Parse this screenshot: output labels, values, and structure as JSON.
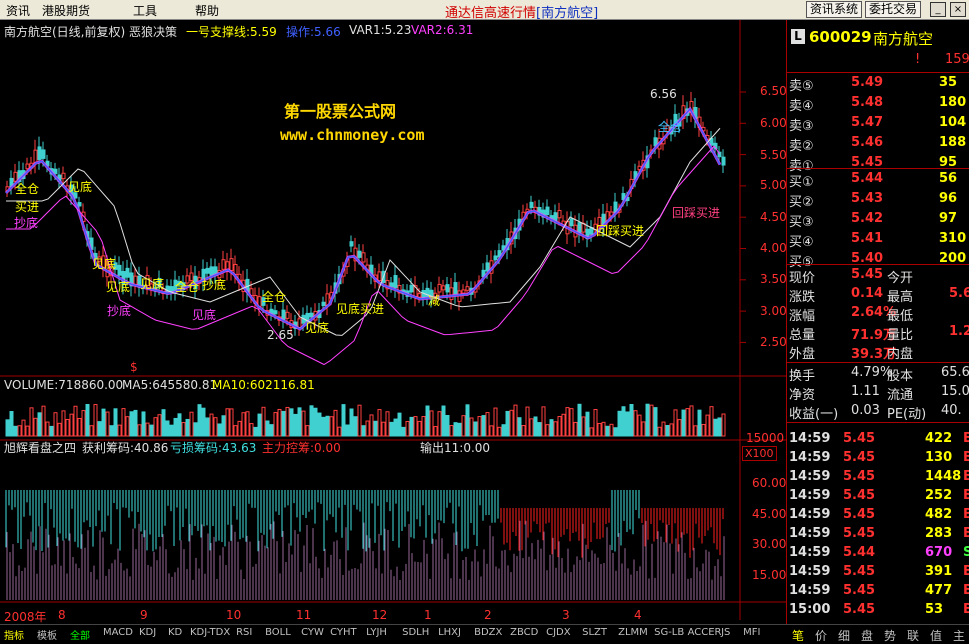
{
  "menu": {
    "items": [
      "资讯",
      "港股期货",
      "工具",
      "帮助"
    ],
    "title_prefix": "通达信高速行情",
    "title_stock": "[南方航空]",
    "btn_info": "资讯系统",
    "btn_trade": "委托交易"
  },
  "main": {
    "stock_label": "南方航空(日线,前复权) 恶狼决策",
    "support": "一号支撑线:5.59",
    "operate": "操作:5.66",
    "var1": "VAR1:5.23",
    "var2": "VAR2:6.31",
    "watermark1": "第一股票公式网",
    "watermark2": "www.chnmoney.com",
    "high_label": "6.56",
    "low_label": "2.65",
    "price_axis": [
      "6.50",
      "6.00",
      "5.50",
      "5.00",
      "4.50",
      "4.00",
      "3.50",
      "3.00",
      "2.50"
    ],
    "annotations": [
      "全仓",
      "买进",
      "抄底",
      "见底",
      "见底",
      "见底",
      "见底",
      "全仓",
      "抄底",
      "抄底",
      "见底",
      "全仓",
      "见底买进",
      "见底",
      "减",
      "全仓",
      "回踩买进",
      "回踩买进"
    ],
    "dollar": "$"
  },
  "volume": {
    "label": "VOLUME:718860.00",
    "ma5": "MA5:645580.81",
    "ma10": "MA10:602116.81",
    "axis": "15000",
    "unit": "X100"
  },
  "indicator": {
    "name": "旭辉看盘之四",
    "profit": "获利筹码:40.86",
    "loss": "亏损筹码:43.63",
    "control": "主力控筹:0.00",
    "output": "输出11:0.00",
    "axis": [
      "60.00",
      "45.00",
      "30.00",
      "15.00"
    ]
  },
  "timeaxis": [
    "2008年",
    "8",
    "9",
    "10",
    "11",
    "12",
    "1",
    "2",
    "3",
    "4"
  ],
  "panel": {
    "code": "600029",
    "name": "南方航空",
    "badge": "L",
    "mark": "!",
    "mark_val": "159",
    "asks": [
      {
        "label": "卖⑤",
        "price": "5.49",
        "vol": "35"
      },
      {
        "label": "卖④",
        "price": "5.48",
        "vol": "180"
      },
      {
        "label": "卖③",
        "price": "5.47",
        "vol": "104"
      },
      {
        "label": "卖②",
        "price": "5.46",
        "vol": "188"
      },
      {
        "label": "卖①",
        "price": "5.45",
        "vol": "95"
      }
    ],
    "bids": [
      {
        "label": "买①",
        "price": "5.44",
        "vol": "56"
      },
      {
        "label": "买②",
        "price": "5.43",
        "vol": "96"
      },
      {
        "label": "买③",
        "price": "5.42",
        "vol": "97"
      },
      {
        "label": "买④",
        "price": "5.41",
        "vol": "310"
      },
      {
        "label": "买⑤",
        "price": "5.40",
        "vol": "200"
      }
    ],
    "stats": [
      {
        "k1": "现价",
        "v1": "5.45",
        "k2": "今开",
        "v2": ""
      },
      {
        "k1": "涨跌",
        "v1": "0.14",
        "k2": "最高",
        "v2": "5.6"
      },
      {
        "k1": "涨幅",
        "v1": "2.64%",
        "k2": "最低",
        "v2": ""
      },
      {
        "k1": "总量",
        "v1": "71.9万",
        "k2": "量比",
        "v2": "1.2"
      },
      {
        "k1": "外盘",
        "v1": "39.3万",
        "k2": "内盘",
        "v2": ""
      }
    ],
    "stats2": [
      {
        "k1": "换手",
        "v1": "4.79%",
        "k2": "股本",
        "v2": "65.6"
      },
      {
        "k1": "净资",
        "v1": "1.11",
        "k2": "流通",
        "v2": "15.0"
      },
      {
        "k1": "收益(一)",
        "v1": "0.03",
        "k2": "PE(动)",
        "v2": "40."
      }
    ],
    "ticks": [
      {
        "t": "14:59",
        "p": "5.45",
        "v": "422",
        "f": "B"
      },
      {
        "t": "14:59",
        "p": "5.45",
        "v": "130",
        "f": "B"
      },
      {
        "t": "14:59",
        "p": "5.45",
        "v": "1448",
        "f": "B"
      },
      {
        "t": "14:59",
        "p": "5.45",
        "v": "252",
        "f": "B"
      },
      {
        "t": "14:59",
        "p": "5.45",
        "v": "482",
        "f": "B"
      },
      {
        "t": "14:59",
        "p": "5.45",
        "v": "283",
        "f": "B"
      },
      {
        "t": "14:59",
        "p": "5.44",
        "v": "670",
        "f": "S"
      },
      {
        "t": "14:59",
        "p": "5.45",
        "v": "391",
        "f": "B"
      },
      {
        "t": "14:59",
        "p": "5.45",
        "v": "477",
        "f": "B"
      },
      {
        "t": "15:00",
        "p": "5.45",
        "v": "53",
        "f": "B"
      }
    ],
    "bottom_tabs": [
      "笔",
      "价",
      "细",
      "盘",
      "势",
      "联",
      "值",
      "主"
    ]
  },
  "tabs": [
    "指标",
    "模板",
    "全部",
    "MACD",
    "KDJ",
    "KD",
    "KDJ-TDX",
    "RSI",
    "BOLL",
    "CYW",
    "CYHT",
    "LYJH",
    "SDLH",
    "LHXJ",
    "BDZX",
    "ZBCD",
    "CJDX",
    "SLZT",
    "ZLMM",
    "SG-LB",
    "ACCER",
    "JS",
    "MFI"
  ]
}
